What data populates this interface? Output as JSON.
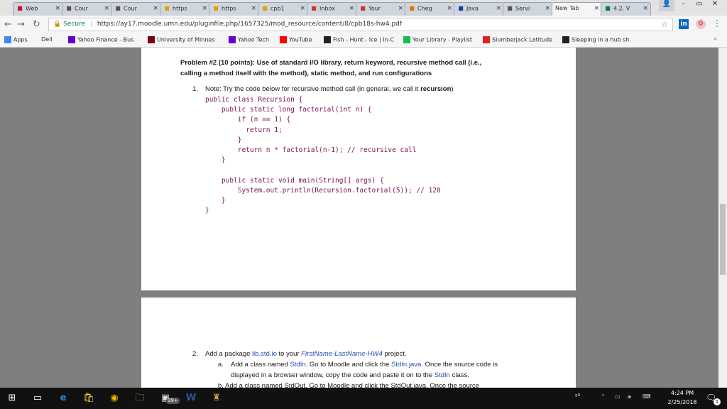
{
  "tabs": [
    {
      "label": "Web",
      "icon": "moodle-icon",
      "icon_color": "#c8102e"
    },
    {
      "label": "Cour",
      "icon": "page-icon",
      "icon_color": "#555"
    },
    {
      "label": "Cour",
      "icon": "page-icon",
      "icon_color": "#555"
    },
    {
      "label": "https",
      "icon": "tn-icon",
      "icon_color": "#e8a000"
    },
    {
      "label": "https",
      "icon": "tn-icon",
      "icon_color": "#e8a000"
    },
    {
      "label": "cpb1",
      "icon": "tn-icon",
      "icon_color": "#e8a000"
    },
    {
      "label": "Inbox",
      "icon": "gmail-icon",
      "icon_color": "#d93025"
    },
    {
      "label": "Your",
      "icon": "gmail-icon",
      "icon_color": "#d93025"
    },
    {
      "label": "Cheg",
      "icon": "chegg-icon",
      "icon_color": "#eb7100"
    },
    {
      "label": "Java",
      "icon": "w-icon",
      "icon_color": "#1a3f8f"
    },
    {
      "label": "Servi",
      "icon": "page-icon",
      "icon_color": "#555"
    },
    {
      "label": "New Tab",
      "icon": "",
      "icon_color": "#555"
    },
    {
      "label": "4.2. V",
      "icon": "doc-icon",
      "icon_color": "#0a7a3a"
    }
  ],
  "toolbar": {
    "secure_label": "Secure",
    "url": "https://ay17.moodle.umn.edu/pluginfile.php/1657325/mod_resource/content/8/cpb18s-hw4.pdf"
  },
  "bookmarks": [
    {
      "label": "Apps",
      "icon": "apps-icon",
      "color": "#4285f4"
    },
    {
      "label": "Dell",
      "icon": "",
      "color": "#999"
    },
    {
      "label": "Yahoo Finance - Bus",
      "icon": "yahoo-icon",
      "color": "#5f01d1"
    },
    {
      "label": "University of Minnes",
      "icon": "umn-icon",
      "color": "#7a0019"
    },
    {
      "label": "Yahoo Tech",
      "icon": "yahoo-icon",
      "color": "#5f01d1"
    },
    {
      "label": "YouTube",
      "icon": "youtube-icon",
      "color": "#ff0000"
    },
    {
      "label": "Fish - Hunt - Ice | In-C",
      "icon": "fish-icon",
      "color": "#222"
    },
    {
      "label": "Your Library - Playlist",
      "icon": "spotify-icon",
      "color": "#1db954"
    },
    {
      "label": "Slumberjack Latitude",
      "icon": "music-icon",
      "color": "#e02020"
    },
    {
      "label": "Sleeping in a hub sh",
      "icon": "fish-icon",
      "color": "#222"
    }
  ],
  "doc": {
    "problem_title_line1": "Problem #2 (10 points): Use of standard I/O library, return keyword, recursive method call (i.e.,",
    "problem_title_line2": "calling a method itself with the method), static method, and run configurations",
    "item1_num": "1.",
    "item1_text": "Note: Try the code below for recursive method call (in general, we call it ",
    "item1_bold": "recursion",
    "item1_end": ")",
    "code_lines": [
      "public class Recursion {",
      "    public static long factorial(int n) {",
      "        if (n == 1) {",
      "          return 1;",
      "        }",
      "        return n * factorial(n-1); // recursive call",
      "    }",
      "",
      "    public static void main(String[] args) {",
      "        System.out.println(Recursion.factorial(5)); // 120",
      "    }",
      "}"
    ],
    "item2_num": "2.",
    "item2_a": "Add a package ",
    "item2_link": "lib.std.io",
    "item2_b": " to your ",
    "item2_italic": "FirstName-LastName-HW4",
    "item2_c": " project.",
    "suba_letter": "a.",
    "suba_1": "Add a class named ",
    "suba_link1": "StdIn",
    "suba_2": ". Go to Moodle and click the ",
    "suba_link2": "StdIn.java",
    "suba_3": ". Once the source code is",
    "suba_line2a": "displayed in a browser window, copy the code and paste it on to the ",
    "suba_link3": "StdIn",
    "suba_line2b": " class.",
    "subb_text": "b.   Add a class named StdOut. Go to Moodle and click the StdOut.java. Once the source"
  },
  "taskbar": {
    "time": "4:24 PM",
    "date": "2/25/2018",
    "badge": "99+",
    "notif_count": "1"
  }
}
